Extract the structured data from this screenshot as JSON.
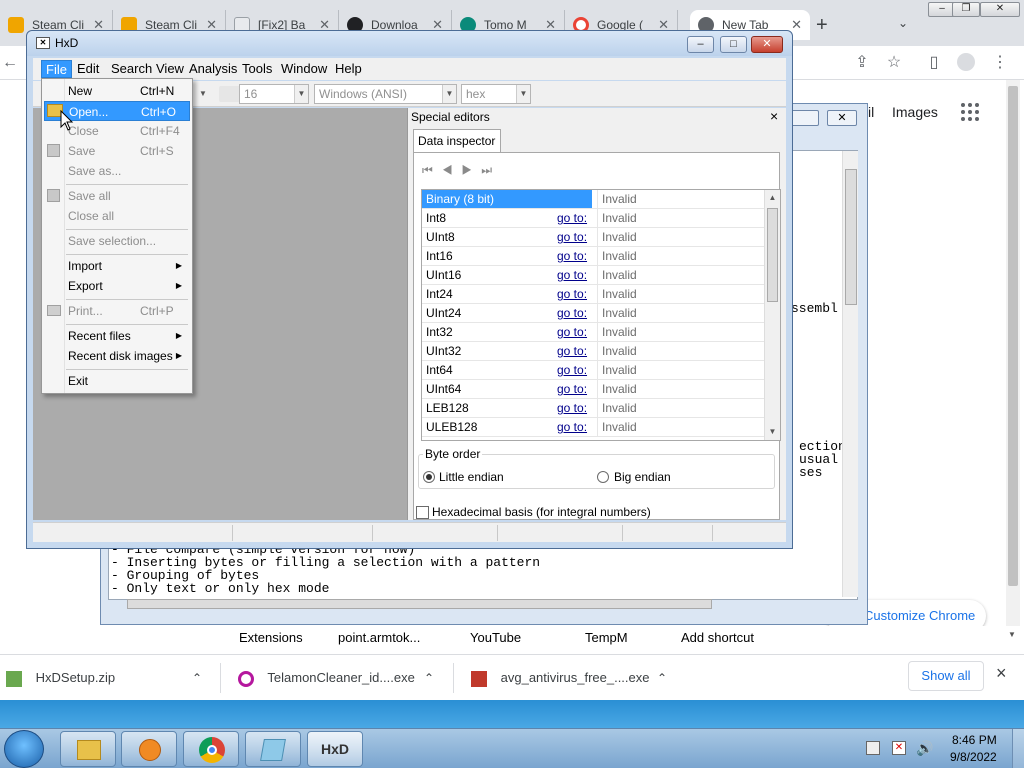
{
  "chrome": {
    "tabs": [
      {
        "title": "Steam Cli",
        "color": "#f0a500"
      },
      {
        "title": "Steam Cli",
        "color": "#f0a500"
      },
      {
        "title": "[Fix2] Ba",
        "color": "#9aa0a6"
      },
      {
        "title": "Downloa",
        "color": "#202124"
      },
      {
        "title": "Tomo M",
        "color": "#0a8a7a"
      },
      {
        "title": "Google (",
        "color": "#ea4335"
      },
      {
        "title": "New Tab",
        "color": "#5f6368"
      }
    ],
    "new_tab_symbol": "+",
    "toolbar": {
      "share_icon": "share-icon",
      "star_icon": "star-icon",
      "sidepanel_icon": "side-panel-icon",
      "profile_icon": "profile-icon",
      "menu_icon": "kebab-menu-icon"
    },
    "ntp": {
      "images_link": "Images",
      "gmail_partial": "il",
      "customize": "Customize Chrome"
    },
    "shortcuts": [
      "Extensions",
      "point.armtok...",
      "YouTube",
      "TempM",
      "Add shortcut"
    ]
  },
  "bg_window": {
    "text_right": [
      "ssembl",
      "ection",
      "usual",
      "ses"
    ],
    "text_lines": [
      "- File compare (simple version for now)",
      "- Inserting bytes or filling a selection with a pattern",
      "- Grouping of bytes",
      "- Only text or only hex mode"
    ]
  },
  "hxd": {
    "title": "HxD",
    "menu": [
      "File",
      "Edit",
      "Search",
      "View",
      "Analysis",
      "Tools",
      "Window",
      "Help"
    ],
    "toolbar": {
      "bytes_per_row": "16",
      "charset": "Windows (ANSI)",
      "offset_base": "hex"
    },
    "special_editors": {
      "title": "Special editors",
      "close": "×",
      "tab": "Data inspector",
      "rows": [
        {
          "name": "Binary (8 bit)",
          "goto": "",
          "value": "Invalid"
        },
        {
          "name": "Int8",
          "goto": "go to:",
          "value": "Invalid"
        },
        {
          "name": "UInt8",
          "goto": "go to:",
          "value": "Invalid"
        },
        {
          "name": "Int16",
          "goto": "go to:",
          "value": "Invalid"
        },
        {
          "name": "UInt16",
          "goto": "go to:",
          "value": "Invalid"
        },
        {
          "name": "Int24",
          "goto": "go to:",
          "value": "Invalid"
        },
        {
          "name": "UInt24",
          "goto": "go to:",
          "value": "Invalid"
        },
        {
          "name": "Int32",
          "goto": "go to:",
          "value": "Invalid"
        },
        {
          "name": "UInt32",
          "goto": "go to:",
          "value": "Invalid"
        },
        {
          "name": "Int64",
          "goto": "go to:",
          "value": "Invalid"
        },
        {
          "name": "UInt64",
          "goto": "go to:",
          "value": "Invalid"
        },
        {
          "name": "LEB128",
          "goto": "go to:",
          "value": "Invalid"
        },
        {
          "name": "ULEB128",
          "goto": "go to:",
          "value": "Invalid"
        }
      ],
      "byte_order_label": "Byte order",
      "little_endian": "Little endian",
      "big_endian": "Big endian",
      "hex_basis": "Hexadecimal basis (for integral numbers)"
    },
    "file_menu": {
      "items": [
        {
          "label": "New",
          "shortcut": "Ctrl+N",
          "disabled": false
        },
        {
          "label": "Open...",
          "shortcut": "Ctrl+O",
          "disabled": false,
          "highlighted": true
        },
        {
          "label": "Close",
          "shortcut": "Ctrl+F4",
          "disabled": true
        },
        {
          "label": "Save",
          "shortcut": "Ctrl+S",
          "disabled": true
        },
        {
          "label": "Save as...",
          "shortcut": "",
          "disabled": true
        },
        {
          "label": "Save all",
          "shortcut": "",
          "disabled": true
        },
        {
          "label": "Close all",
          "shortcut": "",
          "disabled": true
        },
        {
          "label": "Save selection...",
          "shortcut": "",
          "disabled": true
        },
        {
          "label": "Import",
          "shortcut": "",
          "disabled": false,
          "submenu": true
        },
        {
          "label": "Export",
          "shortcut": "",
          "disabled": false,
          "submenu": true
        },
        {
          "label": "Print...",
          "shortcut": "Ctrl+P",
          "disabled": true
        },
        {
          "label": "Recent files",
          "shortcut": "",
          "disabled": false,
          "submenu": true
        },
        {
          "label": "Recent disk images",
          "shortcut": "",
          "disabled": false,
          "submenu": true
        },
        {
          "label": "Exit",
          "shortcut": "",
          "disabled": false
        }
      ]
    }
  },
  "downloads": {
    "items": [
      {
        "name": "HxDSetup.zip",
        "color": "#6aa84f"
      },
      {
        "name": "TelamonCleaner_id....exe",
        "color": "#b5179e"
      },
      {
        "name": "avg_antivirus_free_....exe",
        "color": "#c0392b"
      }
    ],
    "show_all": "Show all",
    "close": "×"
  },
  "taskbar": {
    "time": "8:46 PM",
    "date": "9/8/2022"
  }
}
